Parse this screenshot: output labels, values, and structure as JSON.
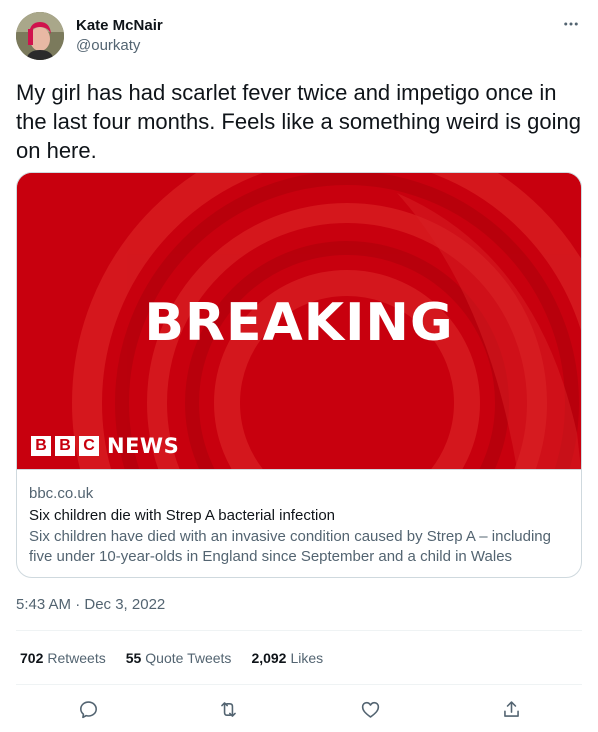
{
  "author": {
    "name": "Kate McNair",
    "handle": "@ourkaty",
    "avatar_icon": "profile-photo"
  },
  "tweet": {
    "text": "My girl has had scarlet fever twice and impetigo once in the last four months. Feels like a something weird is going on here.",
    "timestamp": "5:43 AM · Dec 3, 2022"
  },
  "card": {
    "image_headline": "BREAKING",
    "logo_letters": [
      "B",
      "B",
      "C"
    ],
    "logo_word": "NEWS",
    "domain": "bbc.co.uk",
    "title": "Six children die with Strep A bacterial infection",
    "description": "Six children have died with an invasive condition caused by Strep A – including five under 10-year-olds in England since September and a child in Wales"
  },
  "stats": {
    "retweets_count": "702",
    "retweets_label": "Retweets",
    "quotes_count": "55",
    "quotes_label": "Quote Tweets",
    "likes_count": "2,092",
    "likes_label": "Likes"
  },
  "actions": [
    "reply-icon",
    "retweet-icon",
    "like-icon",
    "share-icon"
  ],
  "colors": {
    "text": "#0f1419",
    "secondary": "#536471",
    "border": "#cfd9de",
    "bbc_red": "#c8000e"
  }
}
